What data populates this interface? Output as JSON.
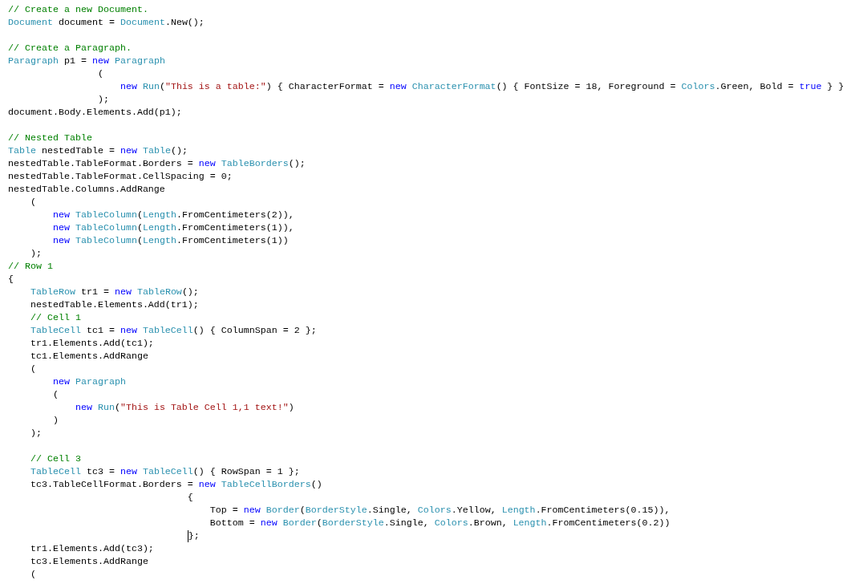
{
  "editor": {
    "lines": [
      {
        "kind": "code",
        "tokens": [
          {
            "kind": "comment",
            "text": "// Create a new Document."
          }
        ]
      },
      {
        "kind": "code",
        "tokens": [
          {
            "kind": "type",
            "text": "Document"
          },
          {
            "kind": "plain",
            "text": " document = "
          },
          {
            "kind": "type",
            "text": "Document"
          },
          {
            "kind": "plain",
            "text": ".New();"
          }
        ]
      },
      {
        "kind": "blank"
      },
      {
        "kind": "code",
        "tokens": [
          {
            "kind": "comment",
            "text": "// Create a Paragraph."
          }
        ]
      },
      {
        "kind": "code",
        "tokens": [
          {
            "kind": "type",
            "text": "Paragraph"
          },
          {
            "kind": "plain",
            "text": " p1 = "
          },
          {
            "kind": "keyword",
            "text": "new "
          },
          {
            "kind": "type",
            "text": "Paragraph"
          }
        ]
      },
      {
        "kind": "code",
        "tokens": [
          {
            "kind": "plain",
            "text": "                ("
          }
        ]
      },
      {
        "kind": "code",
        "tokens": [
          {
            "kind": "keyword",
            "text": "                    new "
          },
          {
            "kind": "type",
            "text": "Run"
          },
          {
            "kind": "plain",
            "text": "("
          },
          {
            "kind": "string",
            "text": "\"This is a table:\""
          },
          {
            "kind": "plain",
            "text": ") { CharacterFormat = "
          },
          {
            "kind": "keyword",
            "text": "new "
          },
          {
            "kind": "type",
            "text": "CharacterFormat"
          },
          {
            "kind": "plain",
            "text": "() { FontSize = 18, Foreground = "
          },
          {
            "kind": "type",
            "text": "Colors"
          },
          {
            "kind": "plain",
            "text": ".Green, Bold = "
          },
          {
            "kind": "keyword",
            "text": "true"
          },
          {
            "kind": "plain",
            "text": " } }"
          }
        ]
      },
      {
        "kind": "code",
        "tokens": [
          {
            "kind": "plain",
            "text": "                );"
          }
        ]
      },
      {
        "kind": "code",
        "tokens": [
          {
            "kind": "plain",
            "text": "document.Body.Elements.Add(p1);"
          }
        ]
      },
      {
        "kind": "blank"
      },
      {
        "kind": "code",
        "tokens": [
          {
            "kind": "comment",
            "text": "// Nested Table"
          }
        ]
      },
      {
        "kind": "code",
        "tokens": [
          {
            "kind": "type",
            "text": "Table"
          },
          {
            "kind": "plain",
            "text": " nestedTable = "
          },
          {
            "kind": "keyword",
            "text": "new "
          },
          {
            "kind": "type",
            "text": "Table"
          },
          {
            "kind": "plain",
            "text": "();"
          }
        ]
      },
      {
        "kind": "code",
        "tokens": [
          {
            "kind": "plain",
            "text": "nestedTable.TableFormat.Borders = "
          },
          {
            "kind": "keyword",
            "text": "new "
          },
          {
            "kind": "type",
            "text": "TableBorders"
          },
          {
            "kind": "plain",
            "text": "();"
          }
        ]
      },
      {
        "kind": "code",
        "tokens": [
          {
            "kind": "plain",
            "text": "nestedTable.TableFormat.CellSpacing = 0;"
          }
        ]
      },
      {
        "kind": "code",
        "tokens": [
          {
            "kind": "plain",
            "text": "nestedTable.Columns.AddRange"
          }
        ]
      },
      {
        "kind": "code",
        "tokens": [
          {
            "kind": "plain",
            "text": "    ("
          }
        ]
      },
      {
        "kind": "code",
        "tokens": [
          {
            "kind": "keyword",
            "text": "        new "
          },
          {
            "kind": "type",
            "text": "TableColumn"
          },
          {
            "kind": "plain",
            "text": "("
          },
          {
            "kind": "type",
            "text": "Length"
          },
          {
            "kind": "plain",
            "text": ".FromCentimeters(2)),"
          }
        ]
      },
      {
        "kind": "code",
        "tokens": [
          {
            "kind": "keyword",
            "text": "        new "
          },
          {
            "kind": "type",
            "text": "TableColumn"
          },
          {
            "kind": "plain",
            "text": "("
          },
          {
            "kind": "type",
            "text": "Length"
          },
          {
            "kind": "plain",
            "text": ".FromCentimeters(1)),"
          }
        ]
      },
      {
        "kind": "code",
        "tokens": [
          {
            "kind": "keyword",
            "text": "        new "
          },
          {
            "kind": "type",
            "text": "TableColumn"
          },
          {
            "kind": "plain",
            "text": "("
          },
          {
            "kind": "type",
            "text": "Length"
          },
          {
            "kind": "plain",
            "text": ".FromCentimeters(1))"
          }
        ]
      },
      {
        "kind": "code",
        "tokens": [
          {
            "kind": "plain",
            "text": "    );"
          }
        ]
      },
      {
        "kind": "code",
        "tokens": [
          {
            "kind": "comment",
            "text": "// Row 1"
          }
        ]
      },
      {
        "kind": "code",
        "tokens": [
          {
            "kind": "plain",
            "text": "{"
          }
        ]
      },
      {
        "kind": "code",
        "tokens": [
          {
            "kind": "type",
            "text": "    TableRow"
          },
          {
            "kind": "plain",
            "text": " tr1 = "
          },
          {
            "kind": "keyword",
            "text": "new "
          },
          {
            "kind": "type",
            "text": "TableRow"
          },
          {
            "kind": "plain",
            "text": "();"
          }
        ]
      },
      {
        "kind": "code",
        "tokens": [
          {
            "kind": "plain",
            "text": "    nestedTable.Elements.Add(tr1);"
          }
        ]
      },
      {
        "kind": "code",
        "tokens": [
          {
            "kind": "comment",
            "text": "    // Cell 1"
          }
        ]
      },
      {
        "kind": "code",
        "tokens": [
          {
            "kind": "type",
            "text": "    TableCell"
          },
          {
            "kind": "plain",
            "text": " tc1 = "
          },
          {
            "kind": "keyword",
            "text": "new "
          },
          {
            "kind": "type",
            "text": "TableCell"
          },
          {
            "kind": "plain",
            "text": "() { ColumnSpan = 2 };"
          }
        ]
      },
      {
        "kind": "code",
        "tokens": [
          {
            "kind": "plain",
            "text": "    tr1.Elements.Add(tc1);"
          }
        ]
      },
      {
        "kind": "code",
        "tokens": [
          {
            "kind": "plain",
            "text": "    tc1.Elements.AddRange"
          }
        ]
      },
      {
        "kind": "code",
        "tokens": [
          {
            "kind": "plain",
            "text": "    ("
          }
        ]
      },
      {
        "kind": "code",
        "tokens": [
          {
            "kind": "keyword",
            "text": "        new "
          },
          {
            "kind": "type",
            "text": "Paragraph"
          }
        ]
      },
      {
        "kind": "code",
        "tokens": [
          {
            "kind": "plain",
            "text": "        ("
          }
        ]
      },
      {
        "kind": "code",
        "tokens": [
          {
            "kind": "keyword",
            "text": "            new "
          },
          {
            "kind": "type",
            "text": "Run"
          },
          {
            "kind": "plain",
            "text": "("
          },
          {
            "kind": "string",
            "text": "\"This is Table Cell 1,1 text!\""
          },
          {
            "kind": "plain",
            "text": ")"
          }
        ]
      },
      {
        "kind": "code",
        "tokens": [
          {
            "kind": "plain",
            "text": "        )"
          }
        ]
      },
      {
        "kind": "code",
        "tokens": [
          {
            "kind": "plain",
            "text": "    );"
          }
        ]
      },
      {
        "kind": "blank"
      },
      {
        "kind": "code",
        "tokens": [
          {
            "kind": "comment",
            "text": "    // Cell 3"
          }
        ]
      },
      {
        "kind": "code",
        "tokens": [
          {
            "kind": "type",
            "text": "    TableCell"
          },
          {
            "kind": "plain",
            "text": " tc3 = "
          },
          {
            "kind": "keyword",
            "text": "new "
          },
          {
            "kind": "type",
            "text": "TableCell"
          },
          {
            "kind": "plain",
            "text": "() { RowSpan = 1 };"
          }
        ]
      },
      {
        "kind": "code",
        "tokens": [
          {
            "kind": "plain",
            "text": "    tc3.TableCellFormat.Borders = "
          },
          {
            "kind": "keyword",
            "text": "new "
          },
          {
            "kind": "type",
            "text": "TableCellBorders"
          },
          {
            "kind": "plain",
            "text": "()"
          }
        ]
      },
      {
        "kind": "code",
        "tokens": [
          {
            "kind": "plain",
            "text": "                                {"
          }
        ]
      },
      {
        "kind": "code",
        "tokens": [
          {
            "kind": "plain",
            "text": "                                    Top = "
          },
          {
            "kind": "keyword",
            "text": "new "
          },
          {
            "kind": "type",
            "text": "Border"
          },
          {
            "kind": "plain",
            "text": "("
          },
          {
            "kind": "type",
            "text": "BorderStyle"
          },
          {
            "kind": "plain",
            "text": ".Single, "
          },
          {
            "kind": "type",
            "text": "Colors"
          },
          {
            "kind": "plain",
            "text": ".Yellow, "
          },
          {
            "kind": "type",
            "text": "Length"
          },
          {
            "kind": "plain",
            "text": ".FromCentimeters(0.15)),"
          }
        ]
      },
      {
        "kind": "code",
        "tokens": [
          {
            "kind": "plain",
            "text": "                                    Bottom = "
          },
          {
            "kind": "keyword",
            "text": "new "
          },
          {
            "kind": "type",
            "text": "Border"
          },
          {
            "kind": "plain",
            "text": "("
          },
          {
            "kind": "type",
            "text": "BorderStyle"
          },
          {
            "kind": "plain",
            "text": ".Single, "
          },
          {
            "kind": "type",
            "text": "Colors"
          },
          {
            "kind": "plain",
            "text": ".Brown, "
          },
          {
            "kind": "type",
            "text": "Length"
          },
          {
            "kind": "plain",
            "text": ".FromCentimeters(0.2))"
          }
        ]
      },
      {
        "kind": "code",
        "tokens": [
          {
            "kind": "plain",
            "text": "                                };",
            "caret": true
          }
        ]
      },
      {
        "kind": "code",
        "tokens": [
          {
            "kind": "plain",
            "text": "    tr1.Elements.Add(tc3);"
          }
        ]
      },
      {
        "kind": "code",
        "tokens": [
          {
            "kind": "plain",
            "text": "    tc3.Elements.AddRange"
          }
        ]
      },
      {
        "kind": "code",
        "tokens": [
          {
            "kind": "plain",
            "text": "    ("
          }
        ]
      }
    ]
  }
}
